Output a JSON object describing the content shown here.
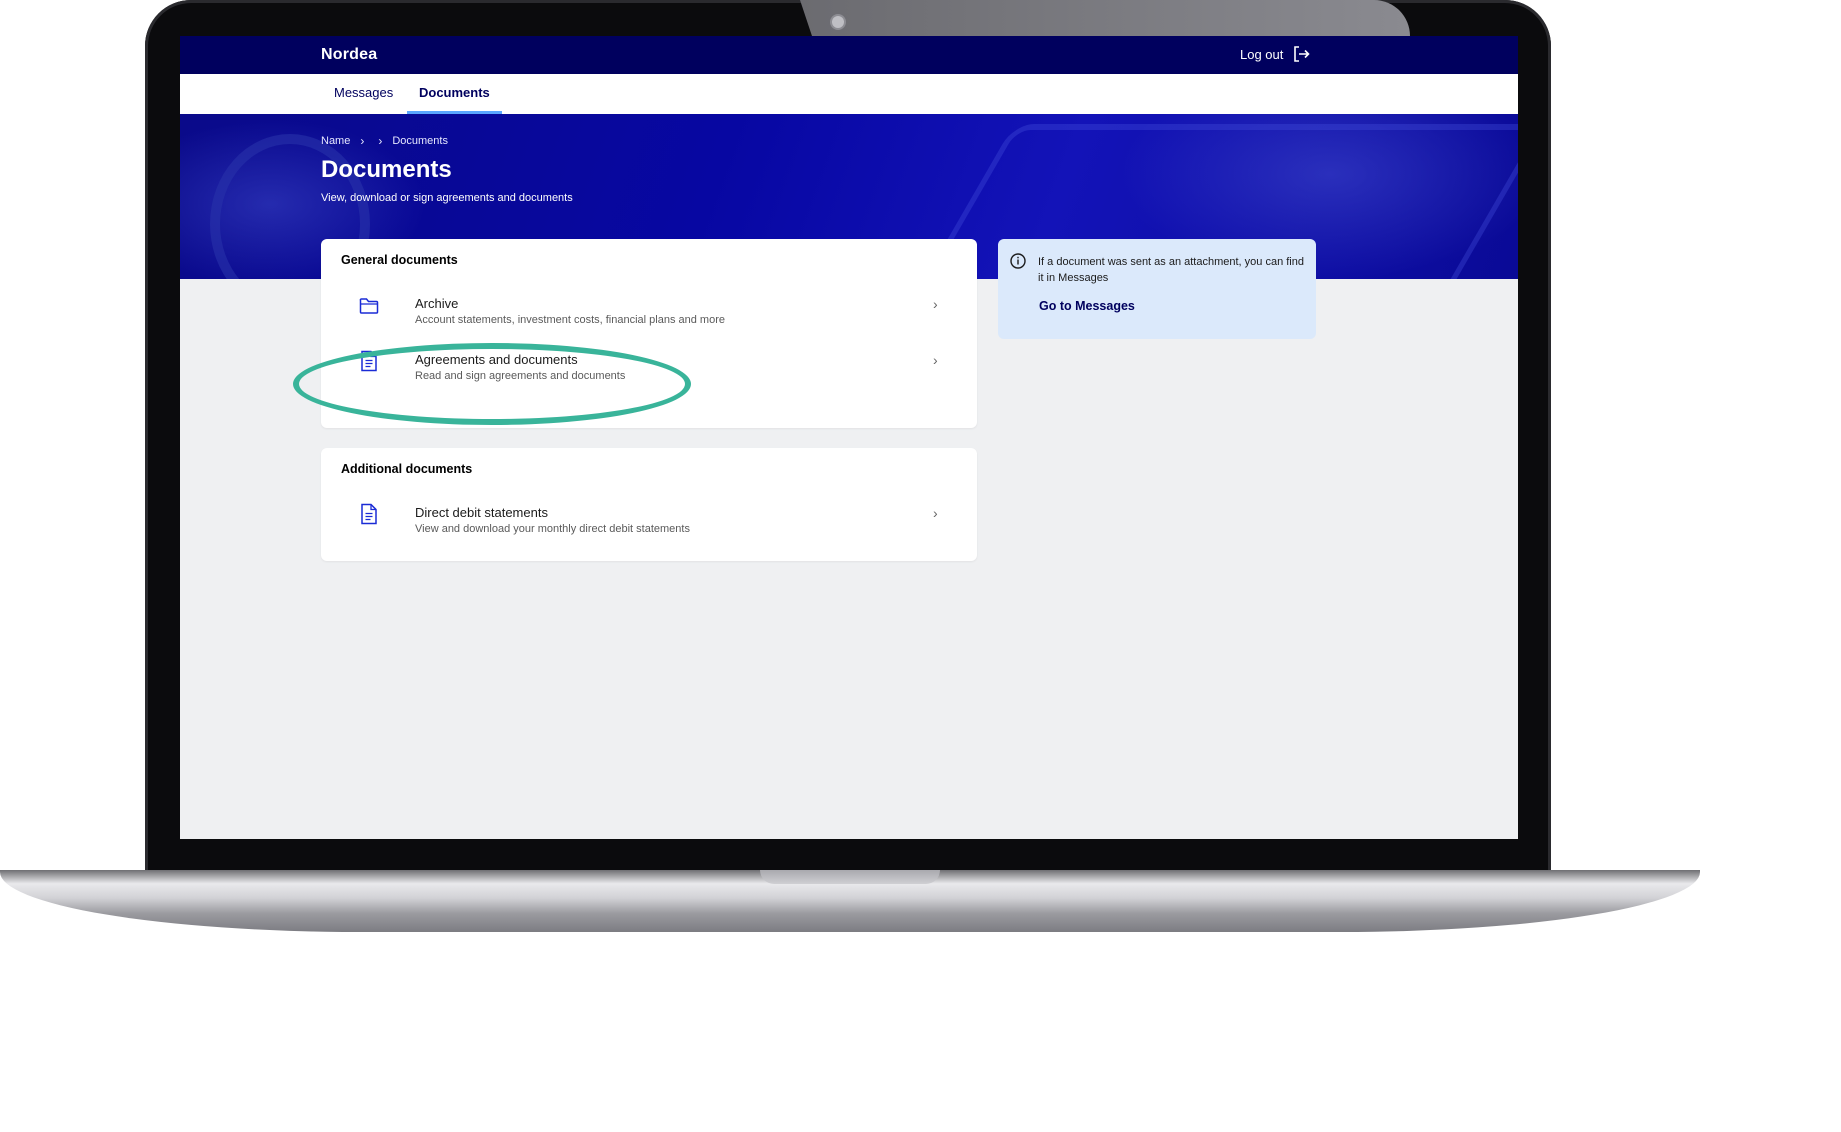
{
  "header": {
    "logo": "Nordea",
    "logout_label": "Log out"
  },
  "tabs": [
    {
      "label": "Messages",
      "active": false
    },
    {
      "label": "Documents",
      "active": true
    }
  ],
  "breadcrumb": [
    "Name",
    "Documents"
  ],
  "page": {
    "title": "Documents",
    "subtitle": "View, download or sign agreements and documents"
  },
  "general_documents": {
    "title": "General documents",
    "items": [
      {
        "title": "Archive",
        "description": "Account statements, investment costs, financial plans and more",
        "icon": "folder-icon"
      },
      {
        "title": "Agreements and documents",
        "description": "Read and sign agreements and documents",
        "icon": "document-icon"
      }
    ]
  },
  "additional_documents": {
    "title": "Additional documents",
    "items": [
      {
        "title": "Direct debit statements",
        "description": "View and download your monthly direct debit statements",
        "icon": "document-icon"
      }
    ]
  },
  "info": {
    "text": "If a document was sent as an attachment, you can find it in Messages",
    "link": "Go to Messages"
  },
  "colors": {
    "brand": "#00005e",
    "accent": "#5aa6ff",
    "highlight": "#39b49a",
    "info_bg": "#dbe9fb"
  }
}
